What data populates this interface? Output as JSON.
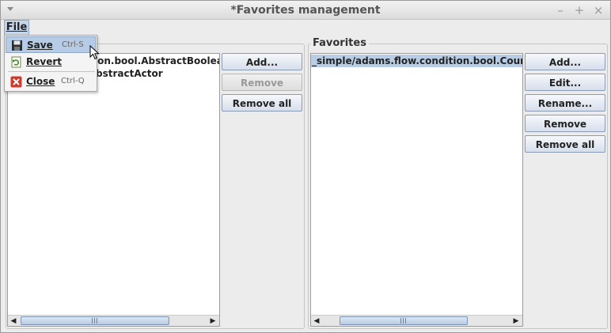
{
  "window": {
    "title": "*Favorites management"
  },
  "menubar": {
    "file_label": "File"
  },
  "file_menu": {
    "items": [
      {
        "label": "Save",
        "accelerator": "Ctrl-S",
        "icon": "save-icon"
      },
      {
        "label": "Revert",
        "icon": "revert-icon"
      },
      {
        "label": "Close",
        "accelerator": "Ctrl-Q",
        "icon": "close-icon"
      }
    ]
  },
  "left_panel": {
    "list_items": [
      "ion.bool.AbstractBoolean",
      "bstractActor"
    ],
    "buttons": {
      "add": "Add...",
      "remove": "Remove",
      "remove_all": "Remove all"
    }
  },
  "right_panel": {
    "title": "Favorites",
    "list_items": [
      "_simple/adams.flow.condition.bool.Counting"
    ],
    "buttons": {
      "add": "Add...",
      "edit": "Edit...",
      "rename": "Rename...",
      "remove": "Remove",
      "remove_all": "Remove all"
    }
  },
  "colors": {
    "selection": "#b7cde6",
    "menu_highlight": "#b6cbe5"
  }
}
